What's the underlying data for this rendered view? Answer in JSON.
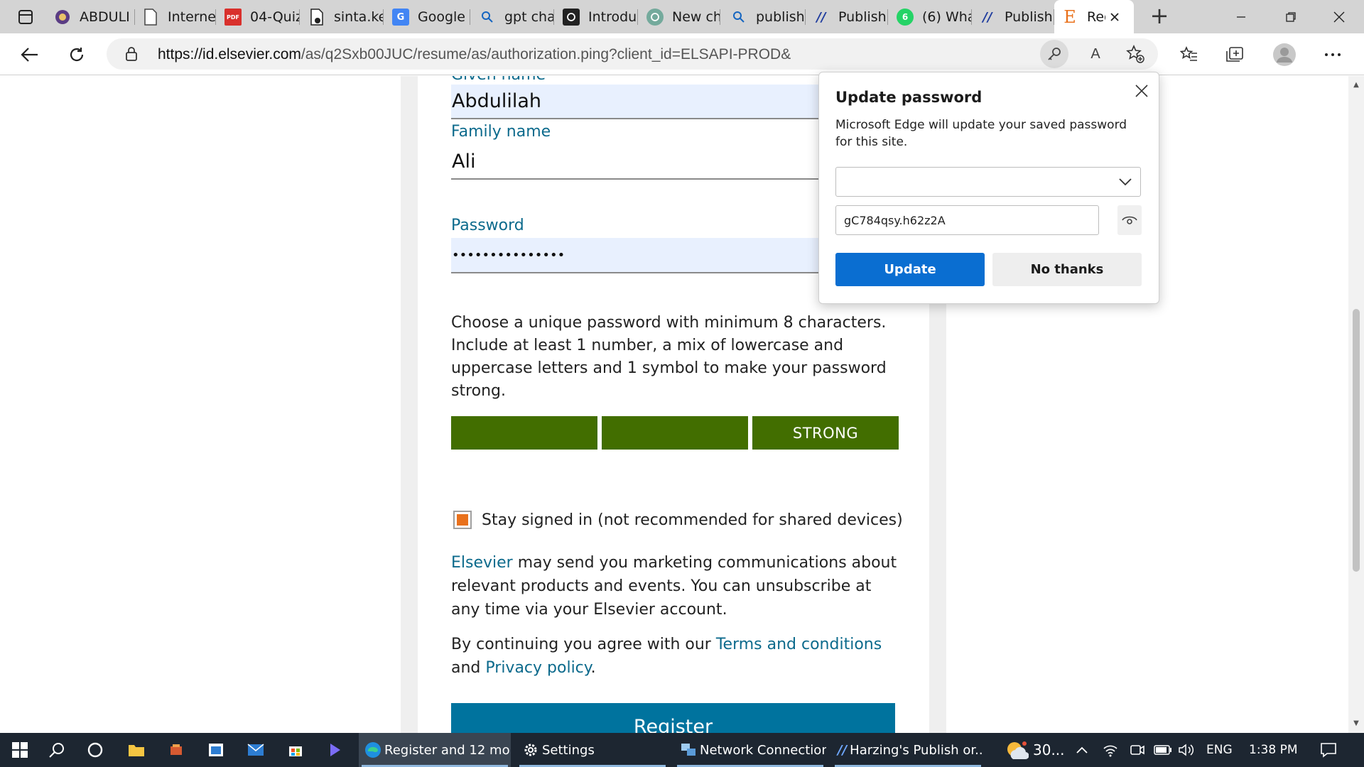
{
  "browser": {
    "tabs": [
      {
        "label": "ABDULI",
        "icon": "university-seal-icon"
      },
      {
        "label": "Internet",
        "icon": "document-icon"
      },
      {
        "label": "04-Quiz",
        "icon": "pdf-icon",
        "badge": "PDF"
      },
      {
        "label": "sinta.ke",
        "icon": "file-download-icon"
      },
      {
        "label": "Google",
        "icon": "google-translate-icon"
      },
      {
        "label": "gpt cha",
        "icon": "search-icon"
      },
      {
        "label": "Introdu",
        "icon": "openai-icon"
      },
      {
        "label": "New ch",
        "icon": "chatgpt-icon"
      },
      {
        "label": "publish",
        "icon": "search-icon"
      },
      {
        "label": "Publish",
        "icon": "publish-or-perish-icon"
      },
      {
        "label": "(6) Wha",
        "icon": "whatsapp-icon",
        "badge": "6"
      },
      {
        "label": "Publish",
        "icon": "publish-or-perish-icon"
      },
      {
        "label": "Reg",
        "icon": "elsevier-icon",
        "badge": "E",
        "active": true
      }
    ],
    "url_host": "https://id.elsevier.com",
    "url_path": "/as/q2Sxb00JUC/resume/as/authorization.ping?client_id=ELSAPI-PROD&"
  },
  "form": {
    "given_name_label": "Given name",
    "given_name_value": "Abdulilah",
    "family_name_label": "Family name",
    "family_name_value": "Ali",
    "password_label": "Password",
    "password_value": "•••••••••••••••",
    "password_hint": "Choose a unique password with minimum 8 characters. Include at least 1 number, a mix of lowercase and uppercase letters and 1 symbol to make your password strong.",
    "strength_label": "STRONG",
    "strength_level": "3 of 3",
    "stay_signed_in": "Stay signed in (not recommended for shared devices)",
    "marketing_brand": "Elsevier",
    "marketing_text": " may send you marketing communications about relevant products and events. You can unsubscribe at any time via your Elsevier account.",
    "terms_prefix": "By continuing you agree with our ",
    "terms_link": "Terms and conditions",
    "terms_and": " and",
    "privacy_link": "Privacy policy",
    "privacy_suffix": ".",
    "register_button": "Register"
  },
  "popup": {
    "title": "Update password",
    "description": "Microsoft Edge will update your saved password for this site.",
    "username_value": "",
    "password_value": "gC784qsy.h62z2A",
    "update_button": "Update",
    "no_thanks_button": "No thanks"
  },
  "taskbar": {
    "apps": [
      {
        "label": "Register and 12 mo...",
        "icon": "edge-icon",
        "active": true
      },
      {
        "label": "Settings",
        "icon": "gear-icon"
      },
      {
        "label": "Network Connections",
        "icon": "network-connections-icon"
      },
      {
        "label": "Harzing's Publish or...",
        "icon": "publish-or-perish-icon"
      }
    ],
    "weather": "30...",
    "language": "ENG",
    "time": "1:38 PM"
  },
  "colors": {
    "accent_link": "#0c6a8c",
    "strength_green": "#426e00",
    "register_blue": "#00739e",
    "edge_update_blue": "#0a6ed1",
    "checkbox_orange": "#e9711c",
    "autofill_bg": "#e8f0fe"
  }
}
